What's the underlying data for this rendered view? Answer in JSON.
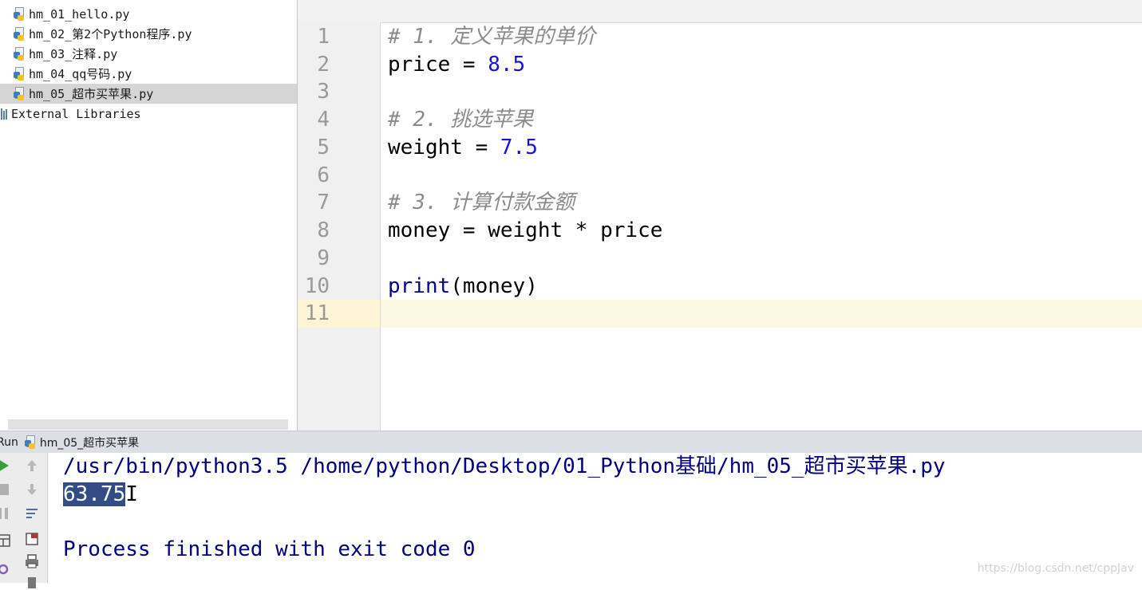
{
  "project": {
    "files": [
      {
        "name": "hm_01_hello.py",
        "selected": false
      },
      {
        "name": "hm_02_第2个Python程序.py",
        "selected": false
      },
      {
        "name": "hm_03_注释.py",
        "selected": false
      },
      {
        "name": "hm_04_qq号码.py",
        "selected": false
      },
      {
        "name": "hm_05_超市买苹果.py",
        "selected": true
      }
    ],
    "external_libraries": "External Libraries"
  },
  "editor": {
    "line_numbers": [
      "1",
      "2",
      "3",
      "4",
      "5",
      "6",
      "7",
      "8",
      "9",
      "10",
      "11"
    ],
    "code": {
      "c1": "# 1. 定义苹果的单价",
      "l2_name": "price",
      "l2_op": " = ",
      "l2_val": "8.5",
      "c4": "# 2. 挑选苹果",
      "l5_name": "weight",
      "l5_op": " = ",
      "l5_val": "7.5",
      "c7": "# 3. 计算付款金额",
      "l8": "money = weight * price",
      "l10_fn": "print",
      "l10_args": "(money)"
    }
  },
  "run": {
    "label": "Run",
    "tab_title": "hm_05_超市买苹果",
    "command": "/usr/bin/python3.5 /home/python/Desktop/01_Python基础/hm_05_超市买苹果.py",
    "output": "63.75",
    "exit_message": "Process finished with exit code 0"
  },
  "watermark": "https://blog.csdn.net/cppJav",
  "colors": {
    "selection": "#324d85",
    "console_text": "#000080",
    "number": "#1414d6",
    "comment": "#8c8c8c",
    "caret_row": "#fdf8e0"
  },
  "icons": {
    "file": "python-file-icon",
    "libraries": "library-icon",
    "run": "play-icon",
    "stop": "stop-icon",
    "pause": "pause-icon"
  }
}
